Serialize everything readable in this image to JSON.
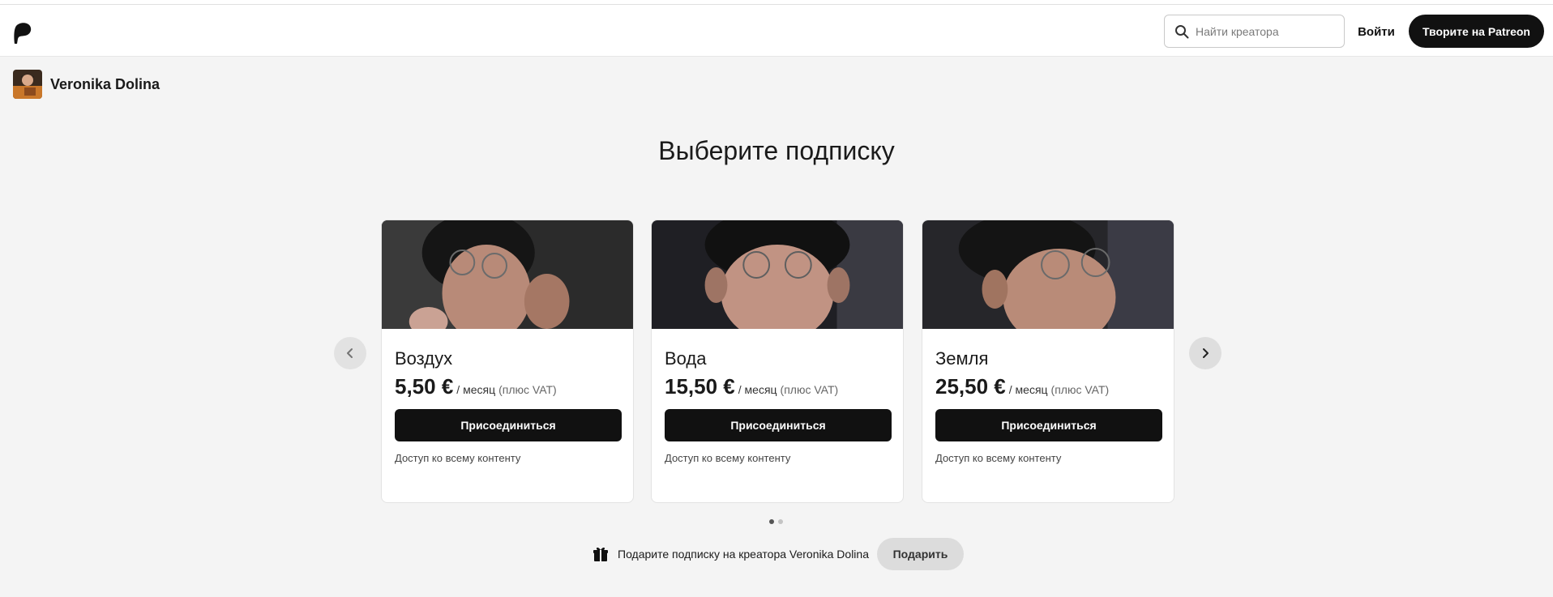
{
  "header": {
    "search_placeholder": "Найти креатора",
    "login_label": "Войти",
    "create_label": "Творите на Patreon"
  },
  "creator": {
    "name": "Veronika Dolina"
  },
  "page": {
    "title": "Выберите подписку"
  },
  "tiers": [
    {
      "name": "Воздух",
      "price": "5,50 €",
      "period": "/ месяц",
      "vat": "(плюс VAT)",
      "button": "Присоединиться",
      "benefit": "Доступ ко всему контенту"
    },
    {
      "name": "Вода",
      "price": "15,50 €",
      "period": "/ месяц",
      "vat": "(плюс VAT)",
      "button": "Присоединиться",
      "benefit": "Доступ ко всему контенту"
    },
    {
      "name": "Земля",
      "price": "25,50 €",
      "period": "/ месяц",
      "vat": "(плюс VAT)",
      "button": "Присоединиться",
      "benefit": "Доступ ко всему контенту"
    }
  ],
  "pagination": {
    "total": 2,
    "active": 1
  },
  "gift": {
    "text": "Подарите подписку на креатора Veronika Dolina",
    "button": "Подарить"
  },
  "colors": {
    "primary": "#111111",
    "background": "#f4f4f4"
  },
  "icons": [
    "patreon-logo-icon",
    "search-icon",
    "chevron-left-icon",
    "chevron-right-icon",
    "gift-icon"
  ]
}
